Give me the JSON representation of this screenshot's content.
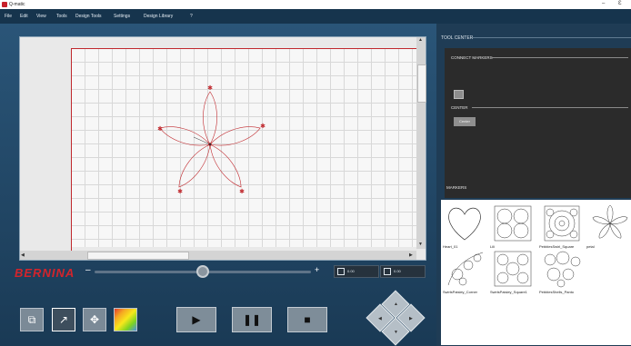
{
  "window": {
    "title": "Q-matic",
    "minimize": "–",
    "restore": "Ɛ"
  },
  "menu": {
    "items": [
      "File",
      "Edit",
      "View",
      "Tools",
      "Design Tools",
      "Settings",
      "Design Library",
      "?"
    ]
  },
  "canvas": {
    "brand": "BERNINA",
    "zoom_minus": "–",
    "zoom_plus": "+",
    "zoom_level": 0.5
  },
  "coords": {
    "x_value": "0.00",
    "y_value": "0.00"
  },
  "toolbar": {
    "tools": [
      {
        "name": "crop",
        "icon": "crop-icon",
        "glyph": "⧉"
      },
      {
        "name": "pen",
        "icon": "pen-icon",
        "glyph": "↗"
      },
      {
        "name": "move",
        "icon": "move-icon",
        "glyph": "✥"
      },
      {
        "name": "color",
        "icon": "color-palette-icon",
        "glyph": ""
      }
    ],
    "play": "▶",
    "pause": "❚❚",
    "stop": "■"
  },
  "tool_center": {
    "title": "TOOL CENTER",
    "connect_markers": "CONNECT MARKERS",
    "center": "CENTER",
    "center_button": "Center",
    "markers": "MARKERS",
    "clear_button": "CLR",
    "help_button": "?",
    "cancel_button": "✕",
    "ok_button": "✓"
  },
  "library": {
    "items": [
      "Heart_01",
      "Lili",
      "PebblesSwirl_Square",
      "petal",
      "SwirlsPaisley_Corner",
      "SwirlsPaisley_Square1",
      "PebblesShells_Panto"
    ]
  },
  "colors": {
    "brand": "#d4242b",
    "accent_blue": "#1c7cd6",
    "accent_red": "#d42a2a",
    "accent_green": "#3fae2b"
  }
}
